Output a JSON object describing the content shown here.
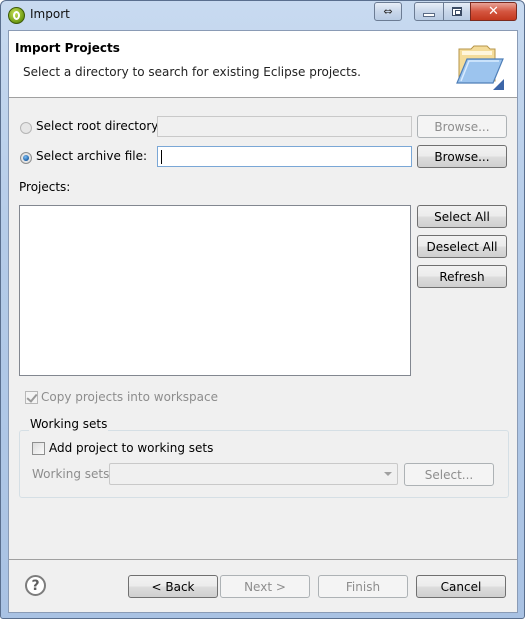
{
  "window": {
    "title": "Import",
    "caption_buttons": {
      "resize_glyph": "⇔",
      "close_glyph": "✕"
    }
  },
  "banner": {
    "title": "Import Projects",
    "description": "Select a directory to search for existing Eclipse projects.",
    "icon": "open-folder-icon"
  },
  "source": {
    "root_directory": {
      "label": "Select root directory:",
      "selected": false,
      "enabled": false,
      "value": "",
      "browse_label": "Browse..."
    },
    "archive_file": {
      "label": "Select archive file:",
      "selected": true,
      "enabled": true,
      "value": "",
      "browse_label": "Browse..."
    }
  },
  "projects": {
    "label": "Projects:",
    "items": [],
    "buttons": {
      "select_all": "Select All",
      "deselect_all": "Deselect All",
      "refresh": "Refresh"
    }
  },
  "options": {
    "copy_into_workspace": {
      "label": "Copy projects into workspace",
      "checked": true,
      "enabled": false
    }
  },
  "working_sets": {
    "group_label": "Working sets",
    "add_checkbox": {
      "label": "Add project to working sets",
      "checked": false
    },
    "field_label": "Working sets:",
    "field_value": "",
    "select_label": "Select..."
  },
  "footer": {
    "help_glyph": "?",
    "back_label": "< Back",
    "next_label": "Next >",
    "finish_label": "Finish",
    "cancel_label": "Cancel"
  }
}
